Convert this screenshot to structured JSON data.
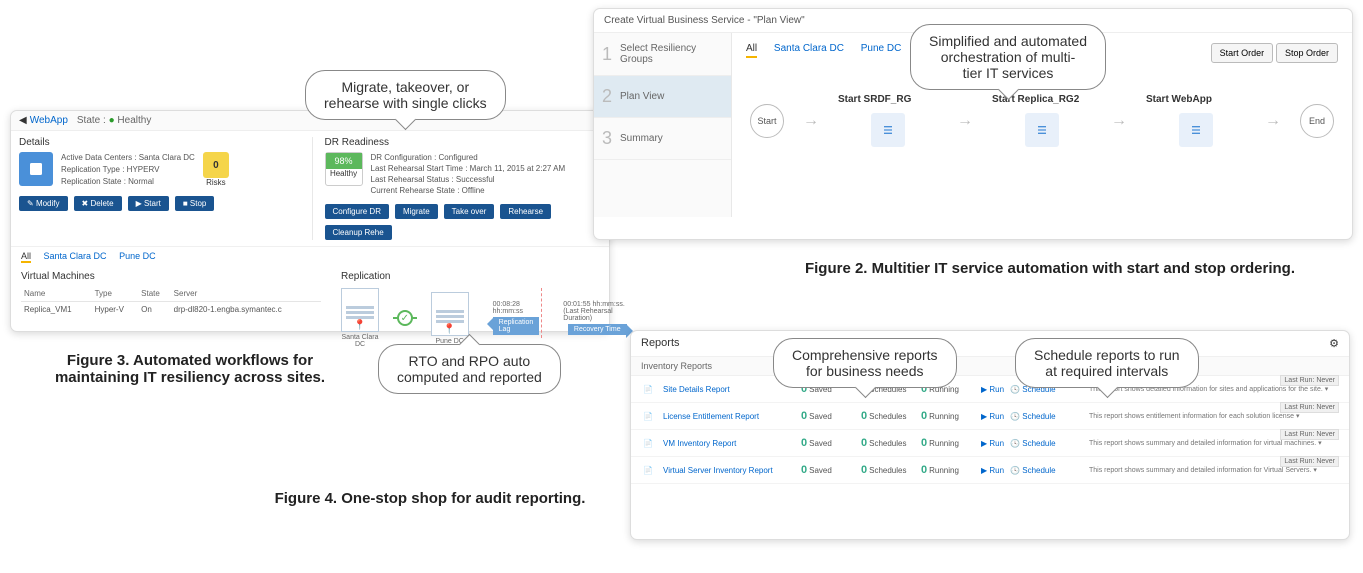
{
  "callouts": {
    "c1": "Migrate, takeover, or\nrehearse with single clicks",
    "c2": "Simplified and automated\norchestration of multi-\ntier IT services",
    "c3": "RTO and RPO auto\ncomputed and reported",
    "c4": "Comprehensive reports\nfor business needs",
    "c5": "Schedule reports to run\nat required intervals"
  },
  "captions": {
    "fig2": "Figure 2. Multitier IT service automation with start and stop ordering.",
    "fig3": "Figure 3. Automated workflows for\nmaintaining IT resiliency across sites.",
    "fig4": "Figure 4. One-stop shop for audit reporting."
  },
  "fig3": {
    "crumb": "WebApp",
    "state_lbl": "State :",
    "state_val": "Healthy",
    "details": {
      "title": "Details",
      "active_dc": "Active Data Centers : Santa Clara DC",
      "repl_type": "Replication Type : HYPERV",
      "repl_state": "Replication State : Normal",
      "risks_n": "0",
      "risks_lbl": "Risks"
    },
    "dr": {
      "title": "DR Readiness",
      "health_pct": "98%",
      "health_lbl": "Healthy",
      "l1": "DR Configuration : Configured",
      "l2": "Last Rehearsal Start Time : March 11, 2015 at 2:27 AM",
      "l3": "Last Rehearsal Status : Successful",
      "l4": "Current Rehearse State : Offline"
    },
    "btns": {
      "modify": "Modify",
      "delete": "Delete",
      "start": "Start",
      "stop": "Stop",
      "configure": "Configure DR",
      "migrate": "Migrate",
      "takeover": "Take over",
      "rehearse": "Rehearse",
      "cleanup": "Cleanup Rehe"
    },
    "tabs": {
      "all": "All",
      "sc": "Santa Clara DC",
      "pune": "Pune DC"
    },
    "vm": {
      "title": "Virtual Machines",
      "cols": {
        "name": "Name",
        "type": "Type",
        "state": "State",
        "server": "Server"
      },
      "row": {
        "name": "Replica_VM1",
        "type": "Hyper-V",
        "state": "On",
        "server": "drp-dl820-1.engba.symantec.c"
      }
    },
    "repl": {
      "title": "Replication",
      "dc1": "Santa Clara DC",
      "dc2": "Pune DC",
      "lag_t": "00:08:28 hh:mm:ss",
      "lag_lbl": "Replication Lag",
      "rec_t": "00:01:55 hh:mm:ss. (Last Rehearsal Duration)",
      "rec_lbl": "Recovery Time"
    }
  },
  "fig2": {
    "title": "Create Virtual Business Service - \"Plan View\"",
    "steps": [
      {
        "n": "1",
        "t": "Select Resiliency Groups"
      },
      {
        "n": "2",
        "t": "Plan View"
      },
      {
        "n": "3",
        "t": "Summary"
      }
    ],
    "tabs": {
      "all": "All",
      "sc": "Santa Clara DC",
      "pune": "Pune DC"
    },
    "order": {
      "start": "Start Order",
      "stop": "Stop Order"
    },
    "flow": {
      "start": "Start",
      "n1": "Start SRDF_RG",
      "n2": "Start Replica_RG2",
      "n3": "Start WebApp",
      "end": "End"
    }
  },
  "fig4": {
    "title": "Reports",
    "sub": "Inventory Reports",
    "cols": {
      "saved": "Saved",
      "sched": "Schedules",
      "run": "Running",
      "runA": "Run",
      "schedA": "Schedule",
      "last": "Last Run: Never"
    },
    "rows": [
      {
        "name": "Site Details Report",
        "desc": "This report shows detailed information for sites and applications for the site."
      },
      {
        "name": "License Entitlement Report",
        "desc": "This report shows entitlement information for each solution license"
      },
      {
        "name": "VM Inventory Report",
        "desc": "This report shows summary and detailed information for virtual machines."
      },
      {
        "name": "Virtual Server Inventory Report",
        "desc": "This report shows summary and detailed information for Virtual Servers."
      }
    ]
  }
}
